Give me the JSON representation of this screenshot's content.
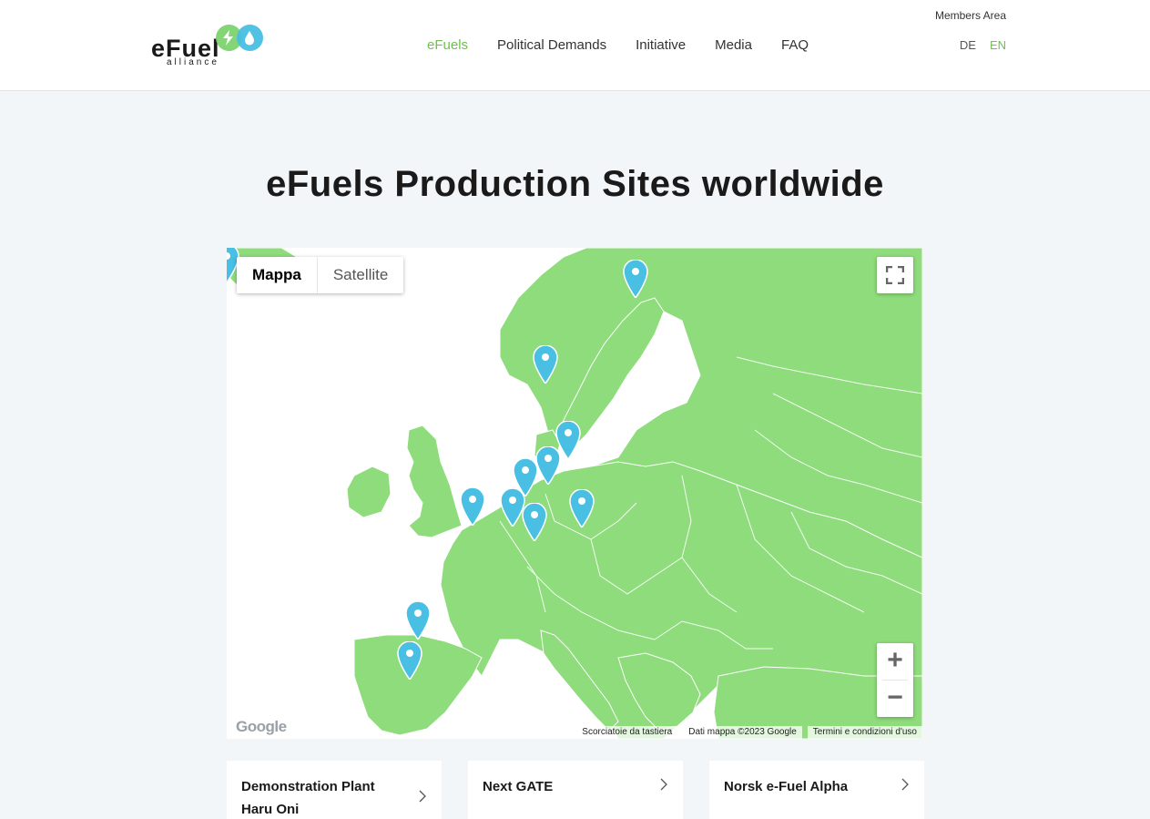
{
  "header": {
    "logo_text": "eFuel",
    "logo_sub": "alliance",
    "nav": [
      {
        "label": "eFuels",
        "active": true
      },
      {
        "label": "Political Demands",
        "active": false
      },
      {
        "label": "Initiative",
        "active": false
      },
      {
        "label": "Media",
        "active": false
      },
      {
        "label": "FAQ",
        "active": false
      }
    ],
    "members_area": "Members Area",
    "languages": [
      {
        "label": "DE",
        "active": false
      },
      {
        "label": "EN",
        "active": true
      }
    ]
  },
  "page_title": {
    "prefix": "eFuels ",
    "bold": "Production Sites",
    "suffix": " worldwide"
  },
  "map": {
    "type_buttons": [
      "Mappa",
      "Satellite"
    ],
    "selected_type": "Mappa",
    "zoom_in": "+",
    "zoom_out": "−",
    "google_mark": "Google",
    "attribution": {
      "shortcuts": "Scorciatoie da tastiera",
      "data": "Dati mappa ©2023 Google",
      "terms": "Termini e condizioni d'uso"
    },
    "colors": {
      "land": "#8edc7b",
      "water": "#ffffff",
      "pin": "#48bfe3",
      "border": "#ffffff"
    },
    "marker_count": 13
  },
  "cards": [
    {
      "title": "Demonstration Plant Haru Oni"
    },
    {
      "title": "Next GATE"
    },
    {
      "title": "Norsk e-Fuel Alpha"
    }
  ]
}
